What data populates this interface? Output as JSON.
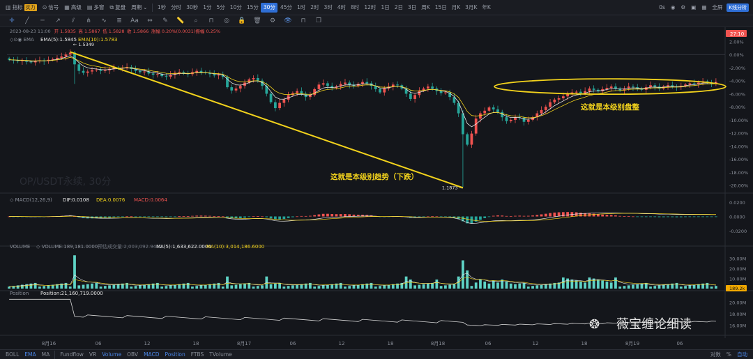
{
  "toolbar": {
    "items": [
      {
        "icon": "indicator-icon",
        "glyph": "▥",
        "label": "指标",
        "badge": "实力"
      },
      {
        "icon": "signal-icon",
        "glyph": "⊙",
        "label": "信号"
      },
      {
        "icon": "advanced-icon",
        "glyph": "▦",
        "label": "高级"
      },
      {
        "icon": "multi-chart-icon",
        "glyph": "▤",
        "label": "多窗"
      },
      {
        "icon": "replay-icon",
        "glyph": "⧉",
        "label": "复盘"
      }
    ],
    "period_label": "周期",
    "timeframes": [
      "1秒",
      "分时",
      "30秒",
      "1分",
      "5分",
      "10分",
      "15分",
      "30分",
      "45分",
      "1时",
      "2时",
      "3时",
      "4时",
      "8时",
      "12时",
      "1日",
      "2日",
      "3日",
      "周K",
      "15日",
      "月K",
      "3月K",
      "年K"
    ],
    "active_timeframe": "30分",
    "right_label": "0s",
    "fullscreen_label": "全屏",
    "kline_btn": "K线分析"
  },
  "drawing_tools": [
    "crosshair-icon",
    "line-icon",
    "horizontal-line-icon",
    "ray-icon",
    "channel-icon",
    "fork-icon",
    "curve-icon",
    "fibonacci-icon",
    "text-icon",
    "measure-icon",
    "brush-icon",
    "ruler-icon",
    "zoom-icon",
    "magnet-icon",
    "eye-icon",
    "lock-icon",
    "delete-icon",
    "settings-icon",
    "visibility-icon",
    "magnet2-icon",
    "layers-icon"
  ],
  "info_line": {
    "date": "2023-08-23 11:00",
    "open": "开 1.5835",
    "high": "高 1.5867",
    "low": "低 1.5828",
    "close": "收 1.5866",
    "change": "涨幅 0.20%(0.0031)",
    "amplitude": "振幅 0.25%"
  },
  "ema_legend": {
    "name": "EMA",
    "ema5": "EMA(5):1.5845",
    "ema10": "EMA(10):1.5783"
  },
  "price_badge": "27:10",
  "chart_data": [
    {
      "type": "candlestick",
      "title": "OP/USDT永续, 30分",
      "watermark": "OP/USDT永续, 30分",
      "y_axis": [
        "2.00%",
        "0.00%",
        "-2.00%",
        "-4.00%",
        "-6.00%",
        "-8.00%",
        "-10.00%",
        "-12.00%",
        "-14.00%",
        "-16.00%",
        "-18.00%",
        "-20.00%"
      ],
      "ylim": [
        -21,
        2.8
      ],
      "high_label": "1.5349",
      "low_label": "1.1873",
      "annotations": [
        "这就是本级别趋势（下跌）",
        "这就是本级别盘整"
      ],
      "series_pct": [
        -0.8,
        -0.9,
        -1.0,
        -0.9,
        -1.1,
        -1.2,
        -1.0,
        -0.9,
        -1.0,
        -0.8,
        -0.7,
        -0.5,
        -0.3,
        0.0,
        0.3,
        -1.5,
        -2.5,
        -2.8,
        -2.6,
        -2.4,
        -2.3,
        -2.5,
        -2.4,
        -2.2,
        -2.0,
        -2.1,
        -2.0,
        -1.9,
        -2.2,
        -2.5,
        -2.7,
        -2.6,
        -2.9,
        -3.1,
        -3.0,
        -3.3,
        -3.4,
        -3.1,
        -2.8,
        -2.7,
        -2.9,
        -3.0,
        -2.7,
        -2.5,
        -2.7,
        -2.8,
        -3.0,
        -3.2,
        -3.1,
        -3.4,
        -5.0,
        -5.5,
        -5.2,
        -4.8,
        -4.3,
        -3.8,
        -3.6,
        -4.0,
        -4.8,
        -6.0,
        -7.3,
        -8.2,
        -7.4,
        -6.9,
        -6.2,
        -5.9,
        -5.6,
        -6.0,
        -6.5,
        -6.2,
        -5.3,
        -4.6,
        -4.4,
        -4.8,
        -5.1,
        -4.9,
        -4.5,
        -4.3,
        -4.6,
        -4.8,
        -4.5,
        -4.2,
        -4.4,
        -4.8,
        -5.3,
        -5.8,
        -5.2,
        -4.9,
        -4.6,
        -4.7,
        -5.2,
        -6.0,
        -6.8,
        -6.2,
        -5.5,
        -5.2,
        -4.9,
        -5.2,
        -5.6,
        -5.9,
        -5.8,
        -6.5,
        -7.4,
        -9.0,
        -12.2,
        -13.8,
        -12.1,
        -9.8,
        -9.0,
        -8.6,
        -8.1,
        -8.4,
        -8.8,
        -9.6,
        -10.2,
        -10.0,
        -9.6,
        -9.7,
        -10.3,
        -10.0,
        -9.6,
        -9.0,
        -8.5,
        -8.0,
        -7.3,
        -6.9,
        -6.7,
        -6.4,
        -6.0,
        -5.8,
        -5.7,
        -5.9,
        -5.6,
        -5.2,
        -5.4,
        -5.6,
        -5.3,
        -5.1,
        -4.9,
        -5.2,
        -5.5,
        -5.2,
        -4.9,
        -5.0,
        -5.2,
        -5.4,
        -5.0,
        -4.7,
        -4.9,
        -5.2,
        -4.9,
        -4.7,
        -4.9,
        -5.0,
        -4.8,
        -4.6,
        -4.4,
        -4.5,
        -4.3,
        -4.1,
        -4.3,
        -4.5,
        -4.2
      ]
    },
    {
      "type": "macd",
      "legend": {
        "name": "MACD(12,26,9)",
        "dif": "DIF:0.0108",
        "dea": "DEA:0.0076",
        "macd": "MACD:0.0064"
      },
      "y_axis": [
        "0.0200",
        "0.0000",
        "-0.0200"
      ],
      "ylim": [
        -0.028,
        0.028
      ]
    },
    {
      "type": "volume",
      "legend": {
        "name": "VOLUME",
        "volume": "VOLUME:189,181.0000",
        "pending": "预估成交量:2,003,092.9412",
        "ma5": "MA(5):1,633,622.0000",
        "ma10": "MA(10):3,014,186.6000"
      },
      "y_axis": [
        "30.00M",
        "20.00M",
        "10.00M"
      ],
      "ylim": [
        0,
        38
      ],
      "last_badge": "189.2k"
    },
    {
      "type": "line",
      "legend": {
        "name": "Position",
        "value": "Position:21,160,719.0000"
      },
      "y_axis": [
        "20.00M",
        "18.00M",
        "16.00M"
      ],
      "ylim": [
        14.5,
        21.5
      ]
    }
  ],
  "x_axis": [
    "8月16",
    "06",
    "12",
    "18",
    "8月17",
    "06",
    "12",
    "18",
    "8月18",
    "06",
    "12",
    "18",
    "8月19",
    "06"
  ],
  "watermark_text": "薇宝缠论细读",
  "bottom": {
    "left": [
      "BOLL",
      "EMA",
      "MA",
      "Fundflow",
      "VR",
      "Volume",
      "OBV",
      "MACD",
      "Position",
      "FTBS",
      "TVolume"
    ],
    "active": [
      "EMA",
      "Volume",
      "MACD",
      "Position"
    ],
    "right_pct": "%",
    "right_auto": "自动",
    "right_log": "对数"
  },
  "colors": {
    "up": "#ef5350",
    "down": "#26a69a",
    "yellow": "#f2d21c",
    "accent": "#2f6fd6"
  }
}
